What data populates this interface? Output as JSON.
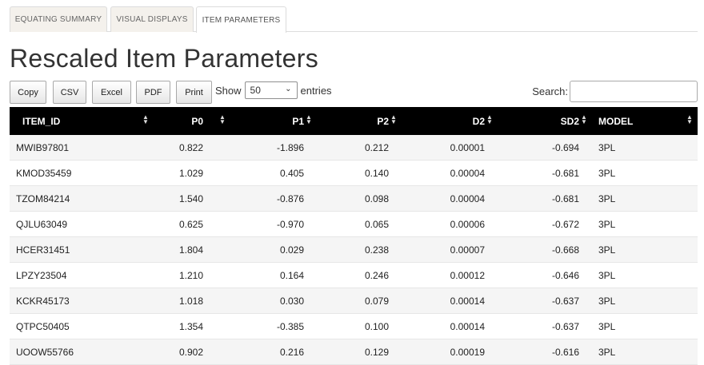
{
  "tabs": [
    {
      "label": "EQUATING SUMMARY",
      "active": false
    },
    {
      "label": "VISUAL DISPLAYS",
      "active": false
    },
    {
      "label": "ITEM PARAMETERS",
      "active": true
    }
  ],
  "page_title": "Rescaled Item Parameters",
  "buttons": {
    "copy": "Copy",
    "csv": "CSV",
    "excel": "Excel",
    "pdf": "PDF",
    "print": "Print"
  },
  "length": {
    "show_label": "Show",
    "selected": "50",
    "entries_label": "entries"
  },
  "search": {
    "label": "Search:",
    "value": ""
  },
  "table": {
    "columns": [
      "ITEM_ID",
      "P0",
      "P1",
      "P2",
      "D2",
      "SD2",
      "MODEL"
    ],
    "rows": [
      [
        "MWIB97801",
        "0.822",
        "-1.896",
        "0.212",
        "0.00001",
        "-0.694",
        "3PL"
      ],
      [
        "KMOD35459",
        "1.029",
        "0.405",
        "0.140",
        "0.00004",
        "-0.681",
        "3PL"
      ],
      [
        "TZOM84214",
        "1.540",
        "-0.876",
        "0.098",
        "0.00004",
        "-0.681",
        "3PL"
      ],
      [
        "QJLU63049",
        "0.625",
        "-0.970",
        "0.065",
        "0.00006",
        "-0.672",
        "3PL"
      ],
      [
        "HCER31451",
        "1.804",
        "0.029",
        "0.238",
        "0.00007",
        "-0.668",
        "3PL"
      ],
      [
        "LPZY23504",
        "1.210",
        "0.164",
        "0.246",
        "0.00012",
        "-0.646",
        "3PL"
      ],
      [
        "KCKR45173",
        "1.018",
        "0.030",
        "0.079",
        "0.00014",
        "-0.637",
        "3PL"
      ],
      [
        "QTPC50405",
        "1.354",
        "-0.385",
        "0.100",
        "0.00014",
        "-0.637",
        "3PL"
      ],
      [
        "UOOW55766",
        "0.902",
        "0.216",
        "0.129",
        "0.00019",
        "-0.616",
        "3PL"
      ]
    ]
  },
  "colors": {
    "header_bg": "#000000",
    "header_text": "#ffffff",
    "stripe": "#f5f5f5",
    "tab_bg": "#f4f1ec"
  },
  "icons": {
    "sort": "sort-both-icon",
    "select": "chevron-down-icon"
  }
}
